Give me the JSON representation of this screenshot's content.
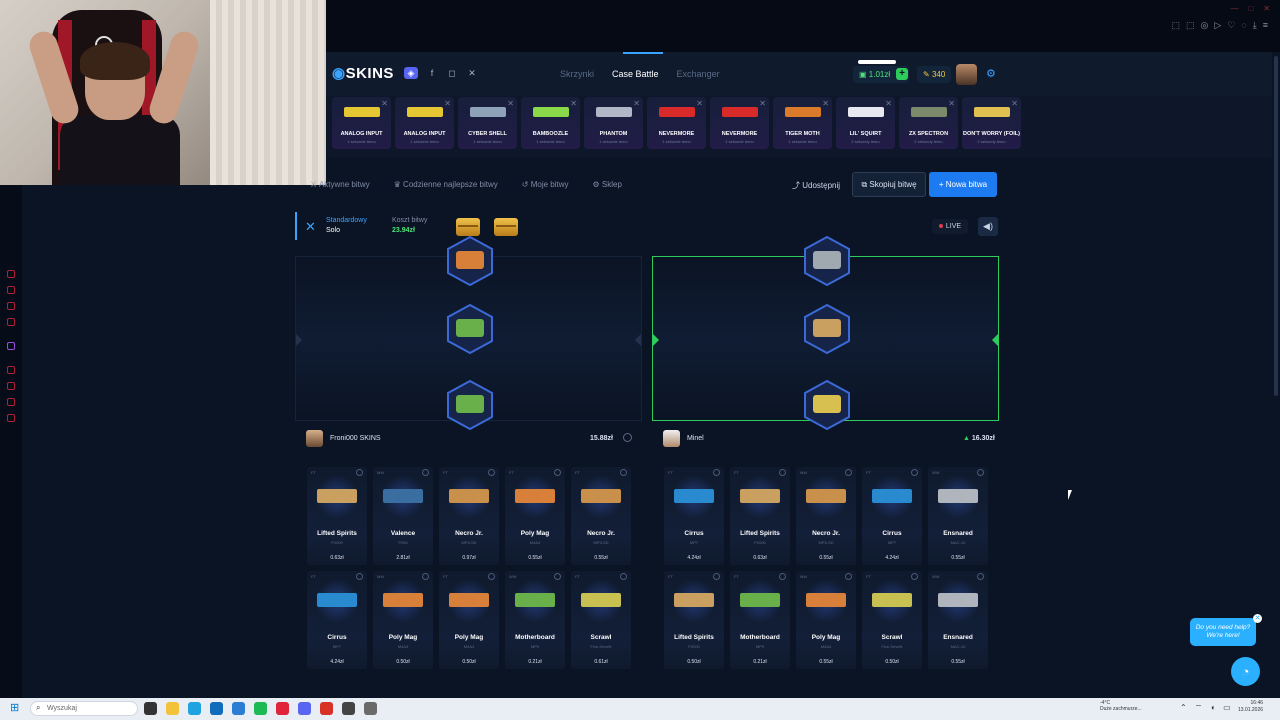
{
  "site": {
    "logo_text": "SKINS",
    "nav": [
      "Skrzynki",
      "Case Battle",
      "Exchanger"
    ],
    "balance": "1.01zł",
    "coins": "340"
  },
  "drops": [
    {
      "name": "ANALOG INPUT",
      "sub": "1 sekunde temu",
      "color": "#e4c733"
    },
    {
      "name": "ANALOG INPUT",
      "sub": "1 sekunde temu",
      "color": "#e4c733"
    },
    {
      "name": "CYBER SHELL",
      "sub": "1 sekunde temu",
      "color": "#8fa3b8"
    },
    {
      "name": "BAMBOOZLE",
      "sub": "1 sekunde temu",
      "color": "#8bd94a"
    },
    {
      "name": "PHANTOM",
      "sub": "1 sekunde temu",
      "color": "#b0b8c8"
    },
    {
      "name": "NEVERMORE",
      "sub": "1 sekunde temu",
      "color": "#d92a2a"
    },
    {
      "name": "NEVERMORE",
      "sub": "1 sekunde temu",
      "color": "#d92a2a"
    },
    {
      "name": "TIGER MOTH",
      "sub": "1 sekunde temu",
      "color": "#d97b2a"
    },
    {
      "name": "LIL' SQUIRT",
      "sub": "2 sekundy temu",
      "color": "#e8e8f0"
    },
    {
      "name": "ZX SPECTRON",
      "sub": "2 sekundy temu",
      "color": "#7a8a6a"
    },
    {
      "name": "DON'T WORRY (FOIL)",
      "sub": "2 sekundy temu",
      "color": "#e0c050"
    }
  ],
  "subnav": {
    "items": [
      "Aktywne bitwy",
      "Codzienne najlepsze bitwy",
      "Moje bitwy",
      "Sklep"
    ],
    "share": "Udostępnij",
    "copy": "Skopiuj bitwę",
    "new_battle": "+ Nowa bitwa"
  },
  "battle": {
    "mode_label": "Standardowy",
    "mode_value": "Solo",
    "cost_label": "Koszt bitwy",
    "cost_value": "23.94zł",
    "live": "LIVE"
  },
  "players": [
    {
      "name": "Froni000 SKINS",
      "total": "15.88zł",
      "items": [
        {
          "wear": "FT",
          "name": "Lifted Spirits",
          "weapon": "P2000",
          "price": "0.63zł",
          "color": "#c9a060"
        },
        {
          "wear": "MW",
          "name": "Valence",
          "weapon": "P250",
          "price": "2.81zł",
          "color": "#3a6ea0"
        },
        {
          "wear": "FT",
          "name": "Necro Jr.",
          "weapon": "MP5-SD",
          "price": "0.97zł",
          "color": "#c8904a"
        },
        {
          "wear": "FT",
          "name": "Poly Mag",
          "weapon": "M4A4",
          "price": "0.55zł",
          "color": "#d8803a"
        },
        {
          "wear": "FT",
          "name": "Necro Jr.",
          "weapon": "MP5-SD",
          "price": "0.55zł",
          "color": "#c8904a"
        },
        {
          "wear": "FT",
          "name": "Cirrus",
          "weapon": "MP7",
          "price": "4.24zł",
          "color": "#2a8ad0"
        },
        {
          "wear": "MW",
          "name": "Poly Mag",
          "weapon": "M4A4",
          "price": "0.50zł",
          "color": "#d8803a"
        },
        {
          "wear": "FT",
          "name": "Poly Mag",
          "weapon": "M4A4",
          "price": "0.50zł",
          "color": "#d8803a"
        },
        {
          "wear": "WW",
          "name": "Motherboard",
          "weapon": "MP9",
          "price": "0.21zł",
          "color": "#6ab04a"
        },
        {
          "wear": "FT",
          "name": "Scrawl",
          "weapon": "Five-SeveN",
          "price": "0.61zł",
          "color": "#c8c050"
        }
      ]
    },
    {
      "name": "Minel",
      "total": "16.30zł",
      "items": [
        {
          "wear": "FT",
          "name": "Cirrus",
          "weapon": "MP7",
          "price": "4.24zł",
          "color": "#2a8ad0"
        },
        {
          "wear": "FT",
          "name": "Lifted Spirits",
          "weapon": "P2000",
          "price": "0.63zł",
          "color": "#c9a060"
        },
        {
          "wear": "MW",
          "name": "Necro Jr.",
          "weapon": "MP5-SD",
          "price": "0.55zł",
          "color": "#c8904a"
        },
        {
          "wear": "FT",
          "name": "Cirrus",
          "weapon": "MP7",
          "price": "4.24zł",
          "color": "#2a8ad0"
        },
        {
          "wear": "WW",
          "name": "Ensnared",
          "weapon": "MAC-10",
          "price": "0.55zł",
          "color": "#b0b4bc"
        },
        {
          "wear": "FT",
          "name": "Lifted Spirits",
          "weapon": "P2000",
          "price": "0.50zł",
          "color": "#c9a060"
        },
        {
          "wear": "FT",
          "name": "Motherboard",
          "weapon": "MP9",
          "price": "0.21zł",
          "color": "#6ab04a"
        },
        {
          "wear": "MW",
          "name": "Poly Mag",
          "weapon": "M4A4",
          "price": "0.55zł",
          "color": "#d8803a"
        },
        {
          "wear": "FT",
          "name": "Scrawl",
          "weapon": "Five-SeveN",
          "price": "0.50zł",
          "color": "#c8c050"
        },
        {
          "wear": "WW",
          "name": "Ensnared",
          "weapon": "MAC-10",
          "price": "0.55zł",
          "color": "#b0b4bc"
        }
      ]
    }
  ],
  "help": {
    "text": "Do you need help? We're here!"
  },
  "taskbar": {
    "search_placeholder": "Wyszukaj",
    "weather": "-4°C",
    "weather_sub": "Duże zachmurze...",
    "time": "16:46",
    "date": "13.01.2026"
  }
}
